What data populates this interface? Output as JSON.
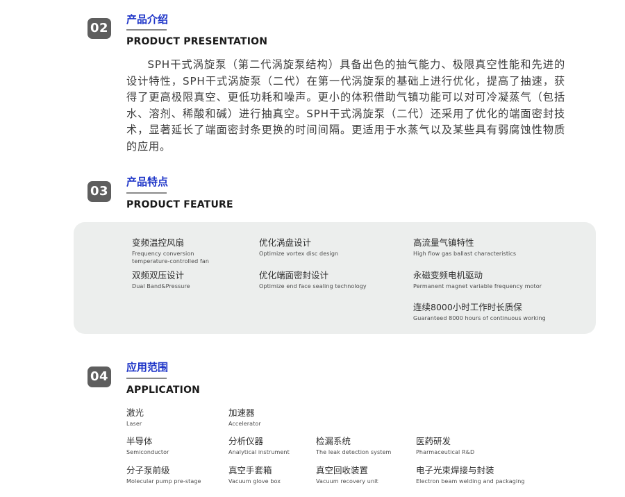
{
  "sections": {
    "presentation": {
      "number": "02",
      "title_cn": "产品介绍",
      "title_en": "PRODUCT PRESENTATION",
      "body": "SPH干式涡旋泵（第二代涡旋泵结构）具备出色的抽气能力、极限真空性能和先进的设计特性，SPH干式涡旋泵（二代）在第一代涡旋泵的基础上进行优化，提高了抽速，获得了更高极限真空、更低功耗和噪声。更小的体积借助气镇功能可以对可冷凝蒸气（包括水、溶剂、稀酸和碱）进行抽真空。SPH干式涡旋泵（二代）还采用了优化的端面密封技术，显著延长了端面密封条更换的时间间隔。更适用于水蒸气以及某些具有弱腐蚀性物质的应用。"
    },
    "feature": {
      "number": "03",
      "title_cn": "产品特点",
      "title_en": "PRODUCT FEATURE",
      "items": [
        {
          "cn": "变频温控风扇",
          "en": "Frequency conversion",
          "en2": "temperature-controlled fan"
        },
        {
          "cn": "优化涡盘设计",
          "en": "Optimize vortex disc design"
        },
        {
          "cn": "高流量气镇特性",
          "en": "High flow gas ballast characteristics"
        },
        {
          "cn": "双频双压设计",
          "en": "Dual Band&Pressure"
        },
        {
          "cn": "优化端面密封设计",
          "en": "Optimize end face sealing technology"
        },
        {
          "cn": "永磁变频电机驱动",
          "en": "Permanent magnet variable frequency motor"
        },
        {
          "cn": "连续8000小时工作时长质保",
          "en": "Guaranteed 8000 hours of continuous working"
        }
      ]
    },
    "application": {
      "number": "04",
      "title_cn": "应用范围",
      "title_en": "APPLICATION",
      "items": [
        {
          "cn": "激光",
          "en": "Laser"
        },
        {
          "cn": "加速器",
          "en": "Accelerator"
        },
        {
          "cn": "半导体",
          "en": "Semiconductor"
        },
        {
          "cn": "分析仪器",
          "en": "Analytical instrument"
        },
        {
          "cn": "检漏系统",
          "en": "The leak detection system"
        },
        {
          "cn": "医药研发",
          "en": "Pharmaceutical R&D"
        },
        {
          "cn": "分子泵前级",
          "en": "Molecular pump pre-stage"
        },
        {
          "cn": "真空手套箱",
          "en": "Vacuum glove box"
        },
        {
          "cn": "真空回收装置",
          "en": "Vacuum recovery unit"
        },
        {
          "cn": "电子光束焊接与封装",
          "en": "Electron beam welding and packaging"
        }
      ]
    }
  },
  "colors": {
    "accent_blue": "#1e35c8",
    "badge_gray": "#5e5e5e",
    "panel_bg": "#eceeed"
  }
}
